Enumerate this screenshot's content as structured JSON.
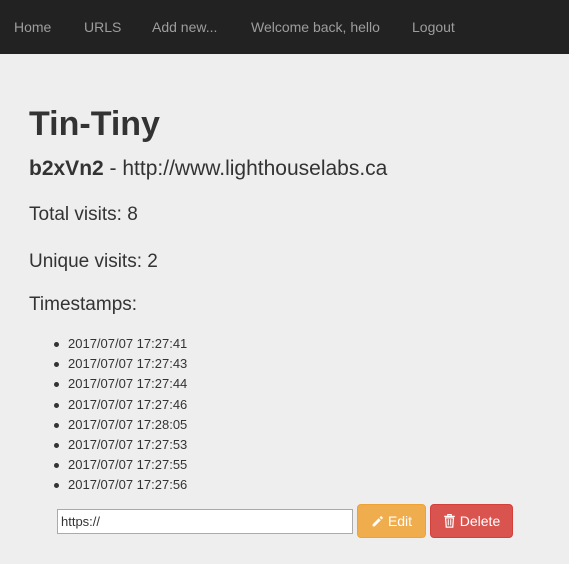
{
  "navbar": {
    "items": [
      {
        "label": "Home"
      },
      {
        "label": "URLS"
      },
      {
        "label": "Add new..."
      },
      {
        "label": "Welcome back, hello"
      },
      {
        "label": "Logout"
      }
    ]
  },
  "main": {
    "title": "Tin-Tiny",
    "short_code": "b2xVn2",
    "separator": " - ",
    "long_url": "http://www.lighthouselabs.ca",
    "total_visits": "Total visits: 8",
    "unique_visits": "Unique visits: 2",
    "timestamps_heading": "Timestamps:",
    "timestamps": [
      "2017/07/07 17:27:41",
      "2017/07/07 17:27:43",
      "2017/07/07 17:27:44",
      "2017/07/07 17:27:46",
      "2017/07/07 17:28:05",
      "2017/07/07 17:27:53",
      "2017/07/07 17:27:55",
      "2017/07/07 17:27:56"
    ]
  },
  "form": {
    "url_value": "https://",
    "edit_label": "Edit",
    "edit_icon": "pencil-icon",
    "delete_label": "Delete",
    "delete_icon": "trash-icon"
  },
  "colors": {
    "navbar_bg": "#222222",
    "nav_text": "#9d9d9d",
    "page_bg": "#eeeeee",
    "edit_button": "#f0ad4e",
    "delete_button": "#d9534f"
  }
}
